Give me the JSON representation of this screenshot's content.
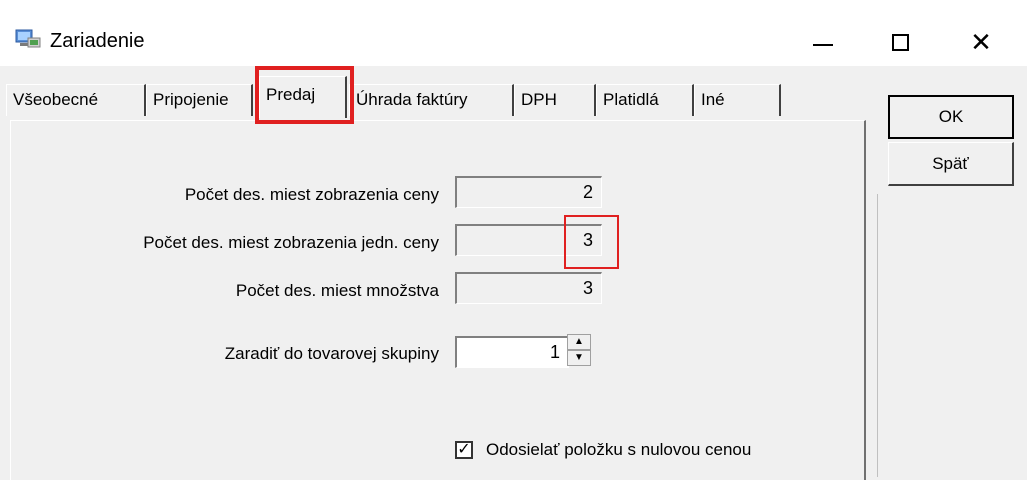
{
  "window": {
    "title": "Zariadenie",
    "icon": "computer-network-icon"
  },
  "titlebar": {
    "minimize_icon": "minimize-icon",
    "maximize_icon": "maximize-icon",
    "close_glyph": "✕"
  },
  "tabs": [
    {
      "label": "Všeobecné",
      "active": false
    },
    {
      "label": "Pripojenie",
      "active": false
    },
    {
      "label": "Predaj",
      "active": true
    },
    {
      "label": "Úhrada faktúry",
      "active": false
    },
    {
      "label": "DPH",
      "active": false
    },
    {
      "label": "Platidlá",
      "active": false
    },
    {
      "label": "Iné",
      "active": false
    }
  ],
  "form": {
    "price_decimals": {
      "label": "Počet des. miest zobrazenia ceny",
      "value": "2"
    },
    "unit_price_decimals": {
      "label": "Počet des. miest zobrazenia jedn. ceny",
      "value": "3"
    },
    "quantity_decimals": {
      "label": "Počet des. miest množstva",
      "value": "3"
    },
    "product_group": {
      "label": "Zaradiť do tovarovej skupiny",
      "value": "1"
    },
    "send_zero_price": {
      "label": "Odosielať položku s nulovou cenou",
      "checked": true
    }
  },
  "buttons": {
    "ok": "OK",
    "back": "Späť"
  },
  "colors": {
    "highlight": "#e02020",
    "background": "#f0f0f0"
  }
}
